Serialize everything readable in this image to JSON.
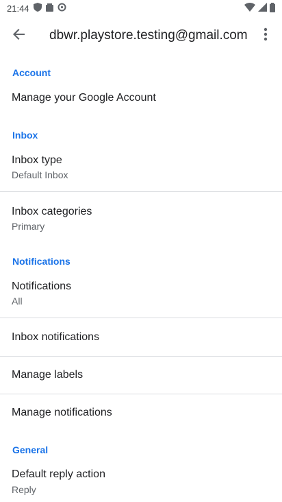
{
  "status": {
    "time": "21:44"
  },
  "appbar": {
    "title": "dbwr.playstore.testing@gmail.com"
  },
  "sections": {
    "account": "Account",
    "inbox": "Inbox",
    "notifications": "Notifications",
    "general": "General"
  },
  "items": {
    "manage_account": {
      "label": "Manage your Google Account"
    },
    "inbox_type": {
      "label": "Inbox type",
      "value": "Default Inbox"
    },
    "inbox_categories": {
      "label": "Inbox categories",
      "value": "Primary"
    },
    "notifications": {
      "label": "Notifications",
      "value": "All"
    },
    "inbox_notifications": {
      "label": "Inbox notifications"
    },
    "manage_labels": {
      "label": "Manage labels"
    },
    "manage_notifications": {
      "label": "Manage notifications"
    },
    "default_reply": {
      "label": "Default reply action",
      "value": "Reply"
    }
  },
  "colors": {
    "accent": "#1a73e8",
    "divider": "#dadce0"
  }
}
